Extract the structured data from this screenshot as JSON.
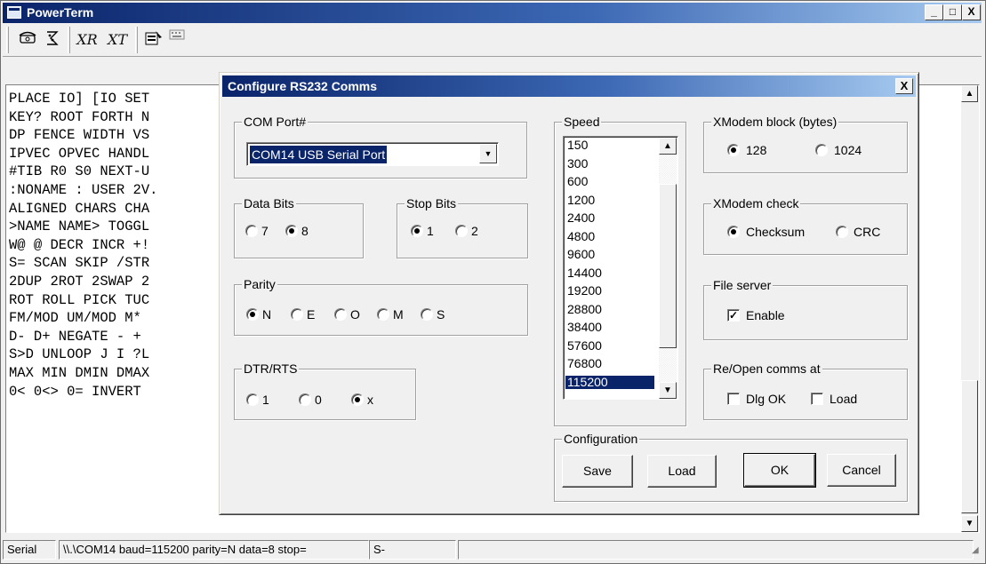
{
  "main_window": {
    "title": "PowerTerm",
    "controls": {
      "minimize": "_",
      "maximize": "□",
      "close": "X"
    }
  },
  "toolbar": {
    "icons": [
      "phone-icon",
      "phone-dial-icon",
      "xr-icon",
      "xt-icon",
      "settings-icon",
      "keyboard-icon"
    ],
    "labels": {
      "xr": "XR",
      "xt": "XT"
    }
  },
  "terminal": {
    "lines": [
      "PLACE IO] [IO SET",
      "KEY? ROOT FORTH N",
      "DP FENCE WIDTH VS",
      "IPVEC OPVEC HANDL",
      "#TIB R0 S0 NEXT-U",
      ":NONAME : USER 2V.",
      "ALIGNED CHARS CHA",
      ">NAME NAME> TOGGL",
      "W@ @ DECR INCR +!",
      "S= SCAN SKIP /STR",
      "2DUP 2ROT 2SWAP 2",
      "ROT ROLL PICK TUC",
      "FM/MOD UM/MOD M* ",
      "D- D+ NEGATE - + ",
      "S>D UNLOOP J I ?L",
      "MAX MIN DMIN DMAX",
      "0< 0<> 0= INVERT "
    ]
  },
  "statusbar": {
    "mode": "Serial",
    "connection": "\\\\.\\COM14 baud=115200 parity=N data=8 stop=",
    "state": "S-"
  },
  "dialog": {
    "title": "Configure RS232 Comms",
    "close": "X",
    "com_port": {
      "label": "COM Port#",
      "value": "COM14 USB Serial Port"
    },
    "data_bits": {
      "label": "Data Bits",
      "options": [
        "7",
        "8"
      ],
      "selected": "8"
    },
    "stop_bits": {
      "label": "Stop Bits",
      "options": [
        "1",
        "2"
      ],
      "selected": "1"
    },
    "parity": {
      "label": "Parity",
      "options": [
        "N",
        "E",
        "O",
        "M",
        "S"
      ],
      "selected": "N"
    },
    "dtr_rts": {
      "label": "DTR/RTS",
      "options": [
        "1",
        "0",
        "x"
      ],
      "selected": "x"
    },
    "speed": {
      "label": "Speed",
      "options": [
        "150",
        "300",
        "600",
        "1200",
        "2400",
        "4800",
        "9600",
        "14400",
        "19200",
        "28800",
        "38400",
        "57600",
        "76800",
        "115200"
      ],
      "selected": "115200"
    },
    "xmodem_block": {
      "label": "XModem block (bytes)",
      "options": [
        "128",
        "1024"
      ],
      "selected": "128"
    },
    "xmodem_check": {
      "label": "XModem check",
      "options": [
        "Checksum",
        "CRC"
      ],
      "selected": "Checksum"
    },
    "file_server": {
      "label": "File server",
      "enable_label": "Enable",
      "enabled": true
    },
    "reopen": {
      "label": "Re/Open comms at",
      "dlg_ok_label": "Dlg OK",
      "load_label": "Load",
      "dlg_ok": false,
      "load": false
    },
    "configuration": {
      "label": "Configuration",
      "save": "Save",
      "load": "Load"
    },
    "ok": "OK",
    "cancel": "Cancel"
  }
}
